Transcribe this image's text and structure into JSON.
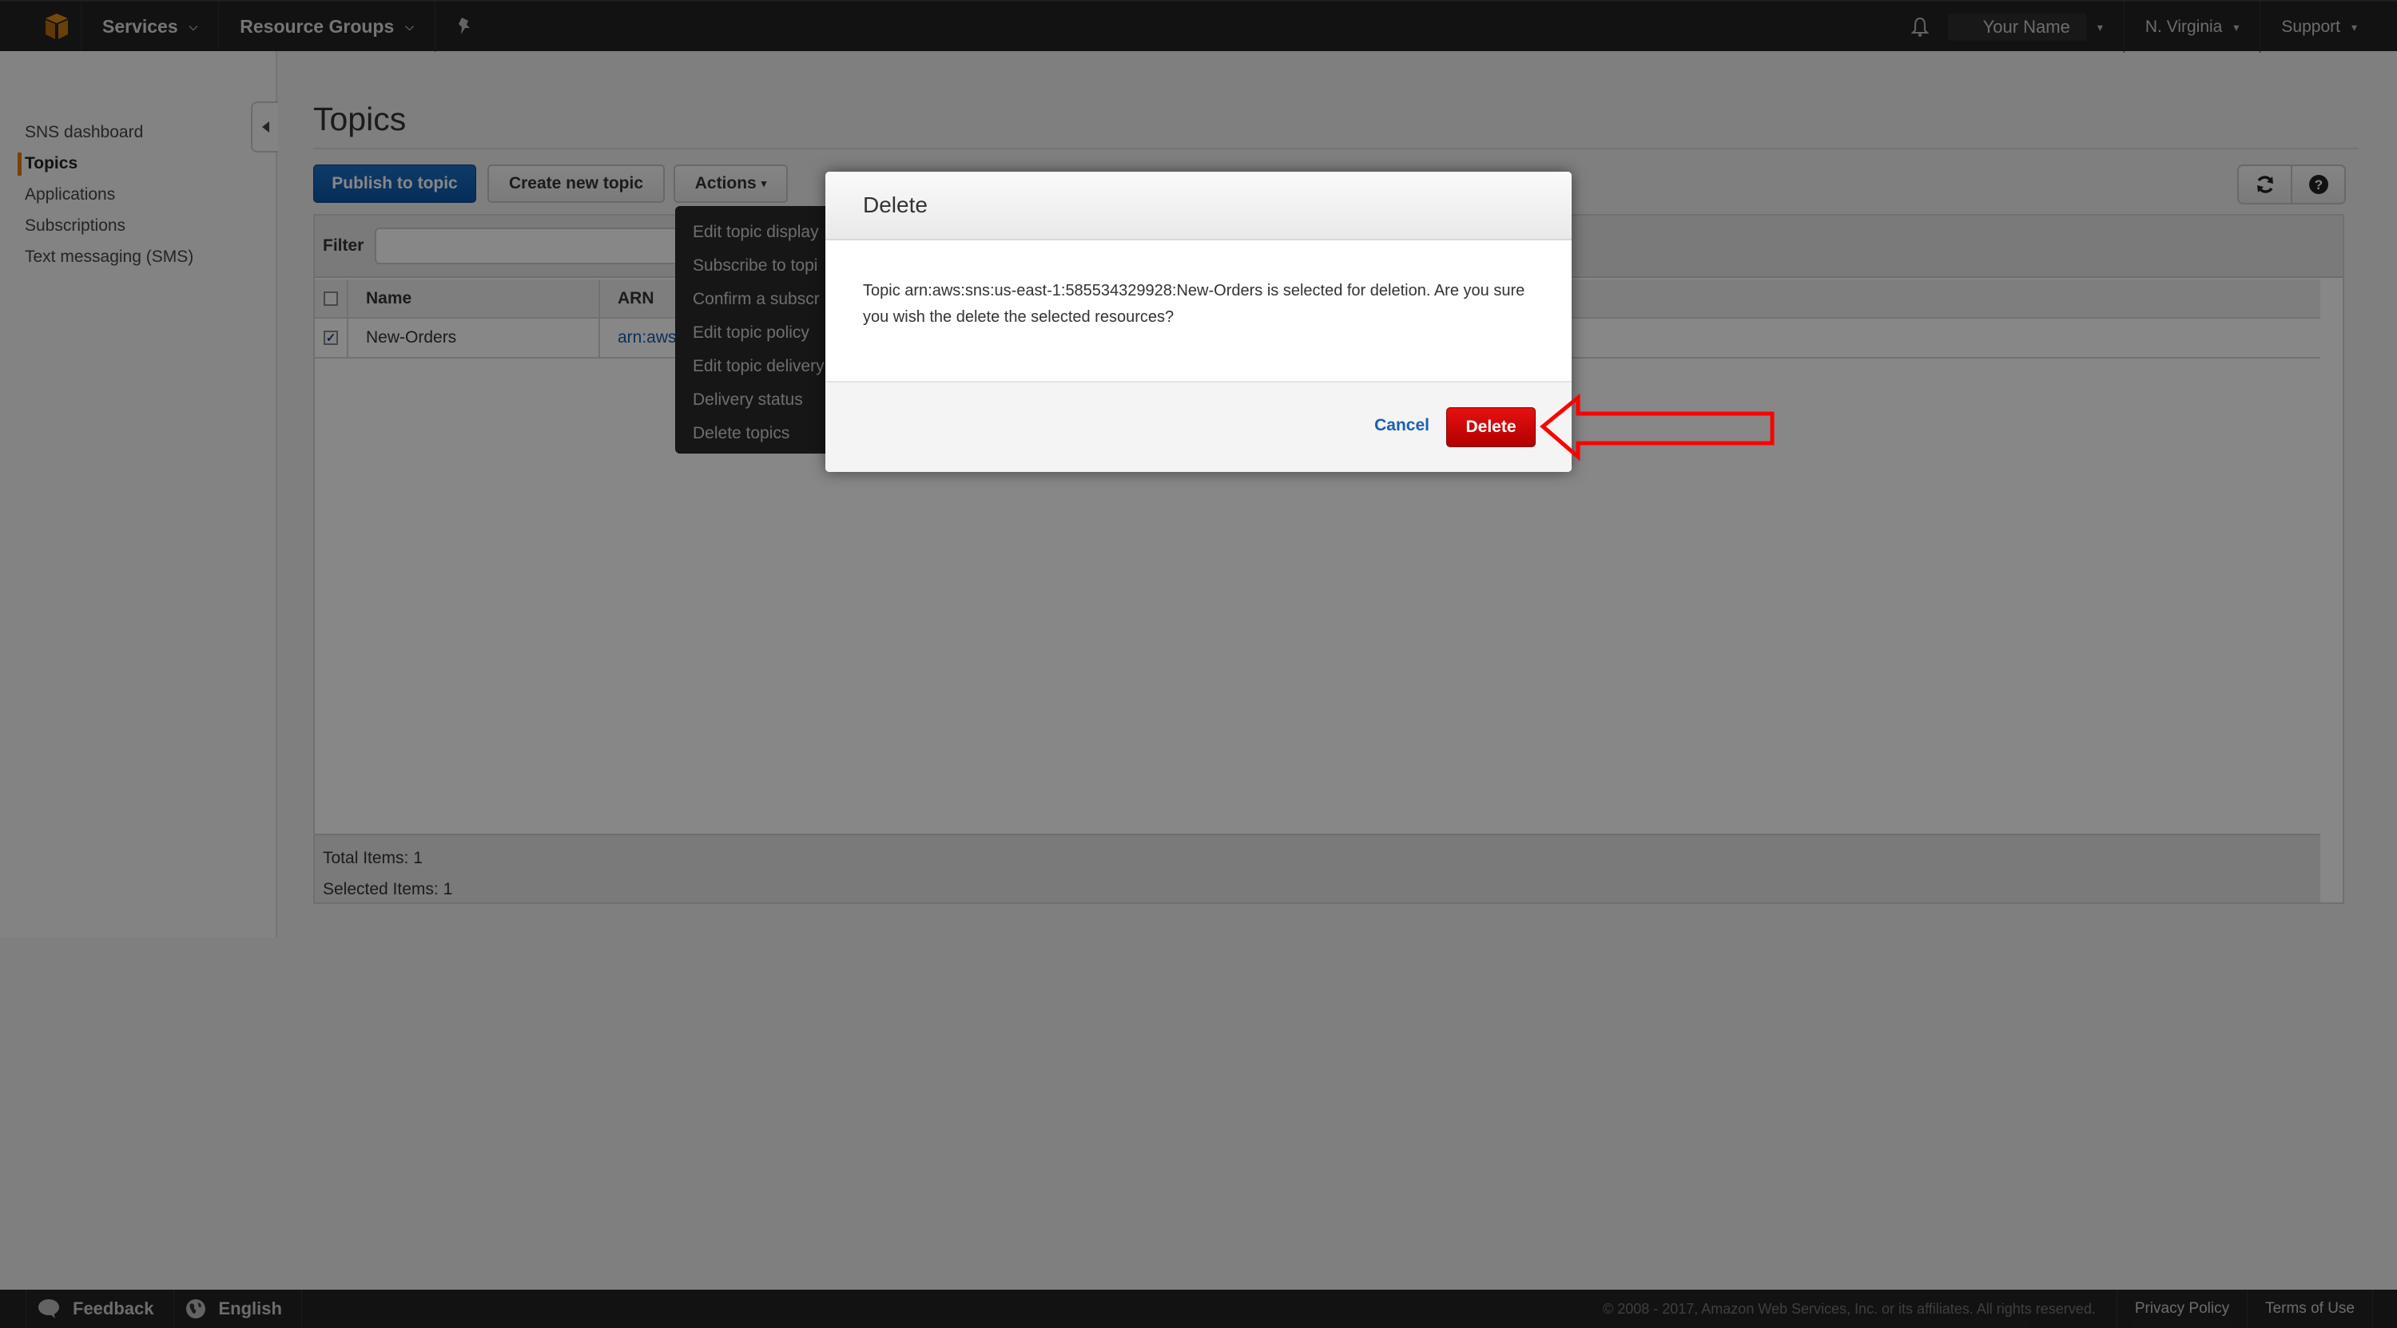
{
  "topnav": {
    "logo_icon": "aws-cube-icon",
    "services_label": "Services",
    "resource_groups_label": "Resource Groups",
    "pin_icon": "pushpin-icon",
    "bell_icon": "bell-icon",
    "user_name": "Your Name",
    "region": "N. Virginia",
    "support": "Support"
  },
  "sidebar": {
    "items": [
      {
        "label": "SNS dashboard",
        "active": false
      },
      {
        "label": "Topics",
        "active": true
      },
      {
        "label": "Applications",
        "active": false
      },
      {
        "label": "Subscriptions",
        "active": false
      },
      {
        "label": "Text messaging (SMS)",
        "active": false
      }
    ]
  },
  "main": {
    "title": "Topics",
    "buttons": {
      "publish": "Publish to topic",
      "create": "Create new topic",
      "actions": "Actions"
    },
    "filter": {
      "label": "Filter",
      "value": "",
      "placeholder": ""
    },
    "table": {
      "columns": [
        "Name",
        "ARN"
      ],
      "rows": [
        {
          "checked": true,
          "name": "New-Orders",
          "arn": "arn:aws"
        }
      ],
      "total_items": "Total Items: 1",
      "selected_items": "Selected Items: 1"
    }
  },
  "actions_menu": {
    "items": [
      "Edit topic display",
      "Subscribe to topi",
      "Confirm a subscr",
      "Edit topic policy",
      "Edit topic delivery",
      "Delivery status",
      "Delete topics"
    ]
  },
  "modal": {
    "title": "Delete",
    "message": "Topic arn:aws:sns:us-east-1:585534329928:New-Orders is selected for deletion. Are you sure you wish the delete the selected resources?",
    "cancel_label": "Cancel",
    "delete_label": "Delete",
    "delete_color": "#d00000"
  },
  "footer": {
    "feedback": "Feedback",
    "language": "English",
    "copyright": "© 2008 - 2017, Amazon Web Services, Inc. or its affiliates. All rights reserved.",
    "privacy": "Privacy Policy",
    "terms": "Terms of Use"
  },
  "annotation": {
    "color": "#ff0000",
    "points_to": "delete-button"
  }
}
